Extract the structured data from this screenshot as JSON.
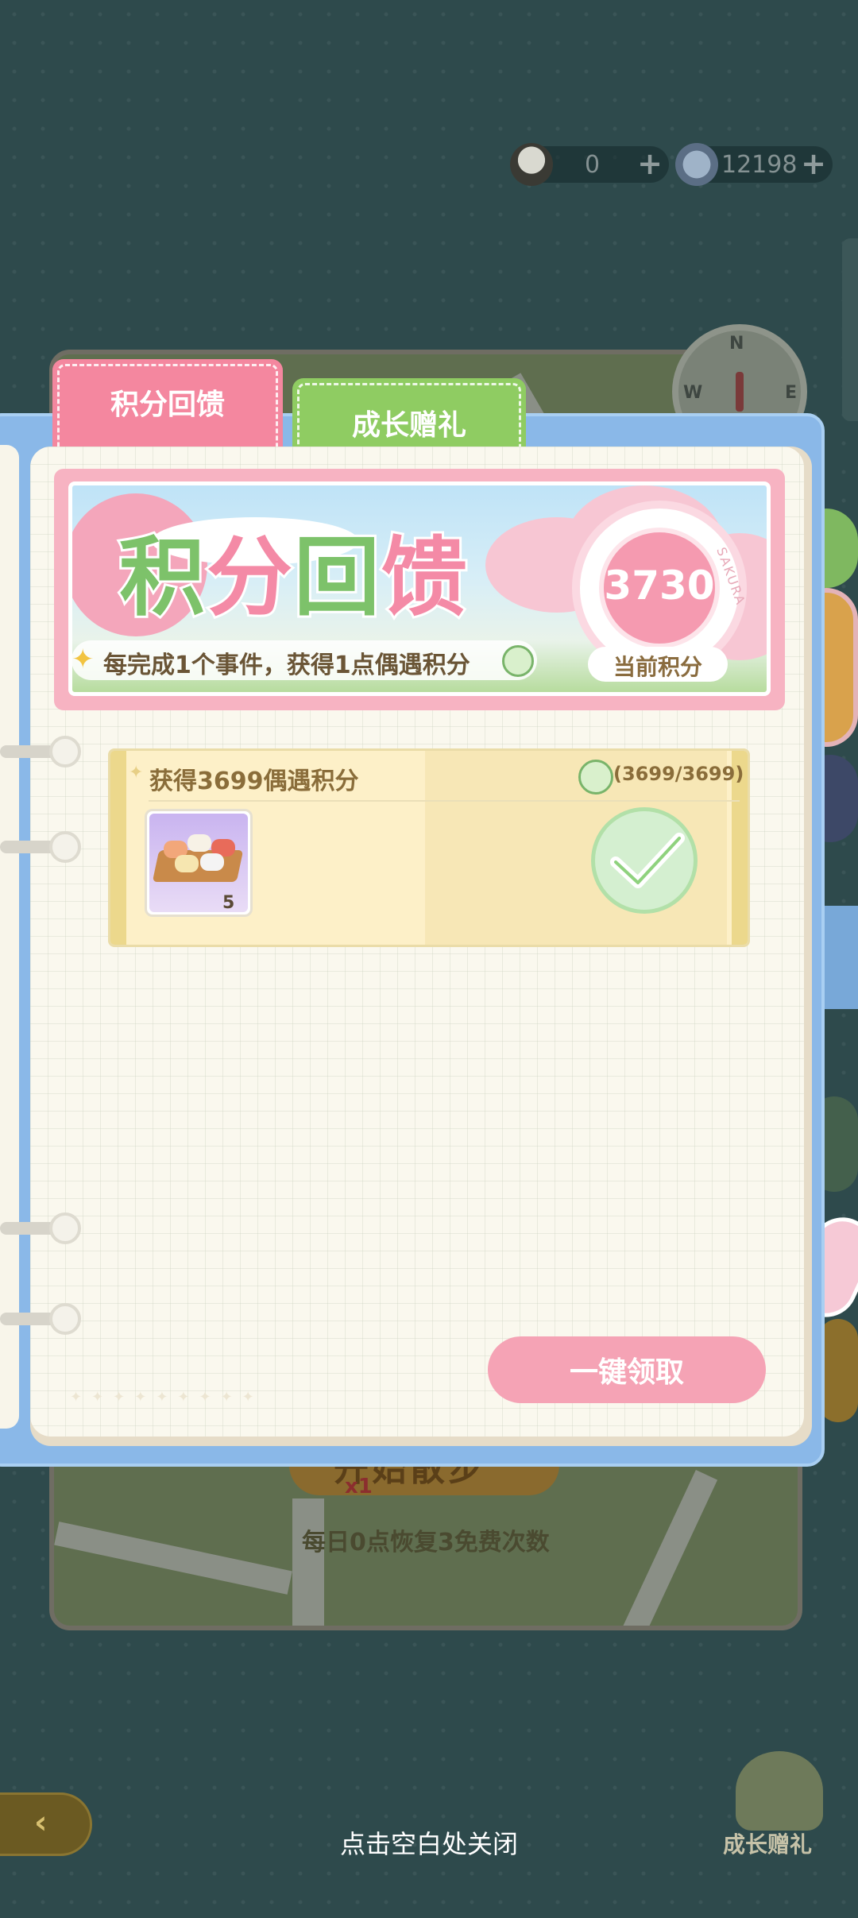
{
  "currency": {
    "rice_ball": "0",
    "gems": "12198",
    "plus": "+"
  },
  "compass": {
    "n": "N",
    "w": "W",
    "e": "E"
  },
  "tabs": [
    {
      "label": "积分回馈",
      "active": true
    },
    {
      "label": "成长赠礼",
      "active": false
    }
  ],
  "banner": {
    "title_part1": "积",
    "title_part2": "分",
    "title_part3": "回",
    "title_part4": "馈",
    "subtitle": "每完成1个事件，获得1点偶遇积分",
    "score": "3730",
    "score_label": "当前积分",
    "stamp_text": "SAKURA"
  },
  "task": {
    "title": "获得3699偶遇积分",
    "progress": "(3699/3699)",
    "reward_count": "5",
    "completed": true
  },
  "claim_all_label": "一键领取",
  "background": {
    "start_label": "开始散步",
    "x_count": "x1",
    "daily_hint": "每日0点恢复3免费次数"
  },
  "close_hint": "点击空白处关闭",
  "bottom_gift_label": "成长赠礼",
  "colors": {
    "tab_active": "#f4879f",
    "tab_inactive": "#8fcc62",
    "claim_button": "#f5a3b5",
    "check": "#9bd98a"
  }
}
